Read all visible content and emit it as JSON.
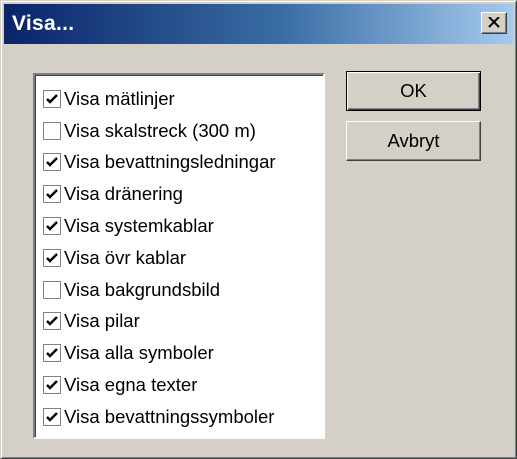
{
  "window": {
    "title": "Visa..."
  },
  "title_bar": {
    "close_icon": "close-icon"
  },
  "list": {
    "items": [
      {
        "label": "Visa mätlinjer",
        "checked": true
      },
      {
        "label": "Visa skalstreck (300 m)",
        "checked": false
      },
      {
        "label": "Visa bevattningsledningar",
        "checked": true
      },
      {
        "label": "Visa dränering",
        "checked": true
      },
      {
        "label": "Visa systemkablar",
        "checked": true
      },
      {
        "label": "Visa övr kablar",
        "checked": true
      },
      {
        "label": "Visa bakgrundsbild",
        "checked": false
      },
      {
        "label": "Visa pilar",
        "checked": true
      },
      {
        "label": "Visa alla symboler",
        "checked": true
      },
      {
        "label": "Visa egna texter",
        "checked": true
      },
      {
        "label": "Visa bevattningssymboler",
        "checked": true
      }
    ]
  },
  "buttons": {
    "ok_label": "OK",
    "cancel_label": "Avbryt"
  },
  "colors": {
    "titlebar_start": "#0a246a",
    "titlebar_end": "#a6caf0",
    "face": "#d4d0c8"
  }
}
